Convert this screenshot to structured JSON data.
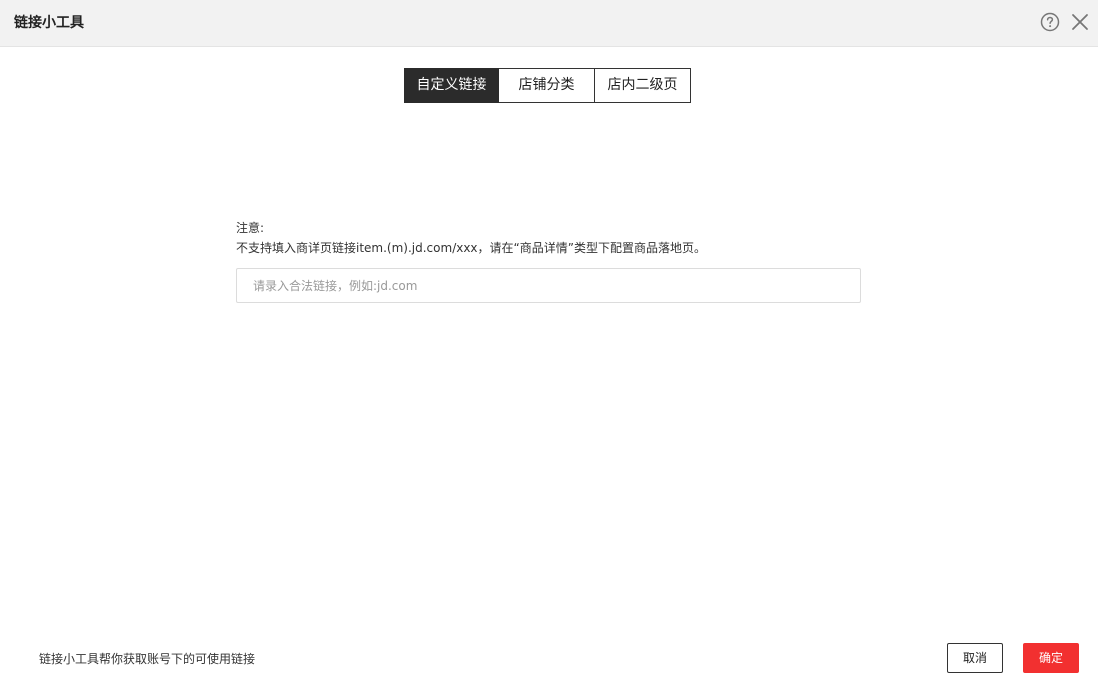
{
  "header": {
    "title": "链接小工具",
    "help_icon": "help-circle-icon",
    "close_icon": "close-icon"
  },
  "tabs": [
    {
      "label": "自定义链接",
      "active": true
    },
    {
      "label": "店铺分类",
      "active": false
    },
    {
      "label": "店内二级页",
      "active": false
    }
  ],
  "notice": {
    "title": "注意:",
    "text": "不支持填入商详页链接item.(m).jd.com/xxx，请在“商品详情”类型下配置商品落地页。"
  },
  "link_input": {
    "value": "",
    "placeholder": "请录入合法链接，例如:jd.com"
  },
  "footer": {
    "text": "链接小工具帮你获取账号下的可使用链接",
    "cancel_label": "取消",
    "ok_label": "确定"
  },
  "colors": {
    "accent": "#f23030",
    "active_tab": "#2b2b2b",
    "header_bg": "#f2f2f2"
  }
}
